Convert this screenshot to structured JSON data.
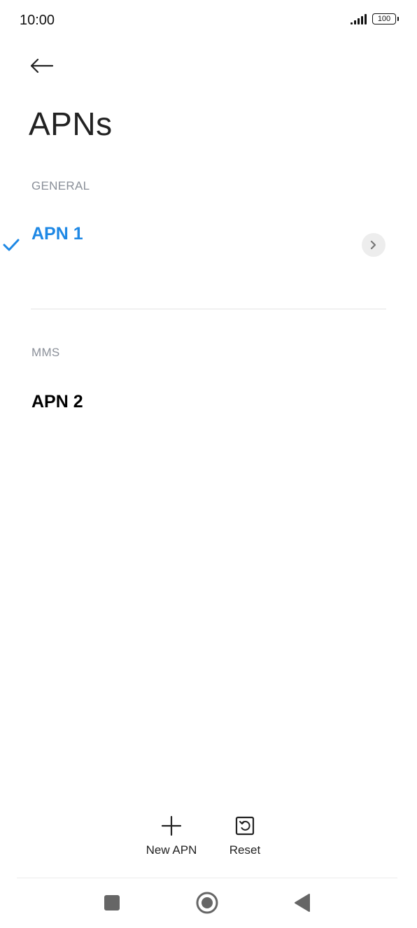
{
  "status_bar": {
    "time": "10:00",
    "battery": "100"
  },
  "header": {
    "title": "APNs"
  },
  "sections": {
    "general": {
      "header": "GENERAL",
      "items": [
        {
          "name": "APN 1",
          "selected": true
        }
      ]
    },
    "mms": {
      "header": "MMS",
      "items": [
        {
          "name": "APN 2",
          "selected": false
        }
      ]
    }
  },
  "actions": {
    "new_apn": "New APN",
    "reset": "Reset"
  },
  "colors": {
    "accent": "#1e88e5",
    "section_header": "#8a8f98",
    "text": "#000000"
  },
  "icons": {
    "back": "back-arrow-icon",
    "check": "check-icon",
    "chevron": "chevron-right-icon",
    "add": "plus-icon",
    "reset": "reset-icon",
    "nav_recents": "square-icon",
    "nav_home": "circle-icon",
    "nav_back": "triangle-back-icon"
  }
}
